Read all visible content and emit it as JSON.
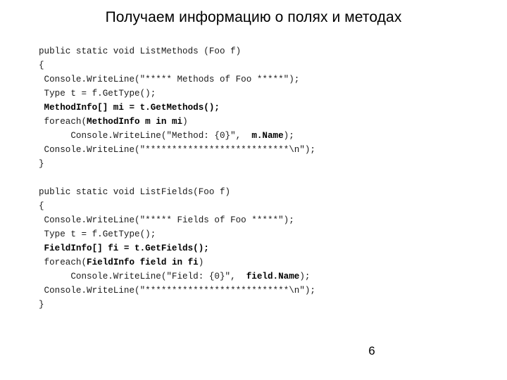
{
  "slide": {
    "title": "Получаем информацию о полях и методах",
    "page_number": "6",
    "background_color": "#ffffff",
    "text_color": "#000000"
  },
  "code": {
    "language": "csharp",
    "blocks": [
      {
        "name": "list-methods",
        "lines": [
          {
            "segments": [
              {
                "text": "public static void ListMethods (Foo f)",
                "bold": false
              }
            ]
          },
          {
            "segments": [
              {
                "text": "{",
                "bold": false
              }
            ]
          },
          {
            "segments": [
              {
                "text": " Console.WriteLine(\"***** Methods of Foo *****\");",
                "bold": false
              }
            ]
          },
          {
            "segments": [
              {
                "text": " Type t = f.GetType();",
                "bold": false
              }
            ]
          },
          {
            "segments": [
              {
                "text": " MethodInfo[] mi = t.GetMethods();",
                "bold": true
              }
            ]
          },
          {
            "segments": [
              {
                "text": " foreach(",
                "bold": false
              },
              {
                "text": "MethodInfo m in mi",
                "bold": true
              },
              {
                "text": ")",
                "bold": false
              }
            ]
          },
          {
            "segments": [
              {
                "text": "      Console.WriteLine(\"Method: {0}\",  ",
                "bold": false
              },
              {
                "text": "m.Name",
                "bold": true
              },
              {
                "text": ");",
                "bold": false
              }
            ]
          },
          {
            "segments": [
              {
                "text": " Console.WriteLine(\"***************************\\n\");",
                "bold": false
              }
            ]
          },
          {
            "segments": [
              {
                "text": "}",
                "bold": false
              }
            ]
          }
        ]
      },
      {
        "name": "spacer",
        "lines": [
          {
            "segments": [
              {
                "text": " ",
                "bold": false
              }
            ]
          }
        ]
      },
      {
        "name": "list-fields",
        "lines": [
          {
            "segments": [
              {
                "text": "public static void ListFields(Foo f)",
                "bold": false
              }
            ]
          },
          {
            "segments": [
              {
                "text": "{",
                "bold": false
              }
            ]
          },
          {
            "segments": [
              {
                "text": " Console.WriteLine(\"***** Fields of Foo *****\");",
                "bold": false
              }
            ]
          },
          {
            "segments": [
              {
                "text": " Type t = f.GetType();",
                "bold": false
              }
            ]
          },
          {
            "segments": [
              {
                "text": " FieldInfo[] fi = t.GetFields();",
                "bold": true
              }
            ]
          },
          {
            "segments": [
              {
                "text": " foreach(",
                "bold": false
              },
              {
                "text": "FieldInfo field in fi",
                "bold": true
              },
              {
                "text": ")",
                "bold": false
              }
            ]
          },
          {
            "segments": [
              {
                "text": "      Console.WriteLine(\"Field: {0}\",  ",
                "bold": false
              },
              {
                "text": "field.Name",
                "bold": true
              },
              {
                "text": ");",
                "bold": false
              }
            ]
          },
          {
            "segments": [
              {
                "text": " Console.WriteLine(\"***************************\\n\");",
                "bold": false
              }
            ]
          },
          {
            "segments": [
              {
                "text": "}",
                "bold": false
              }
            ]
          }
        ]
      }
    ]
  }
}
